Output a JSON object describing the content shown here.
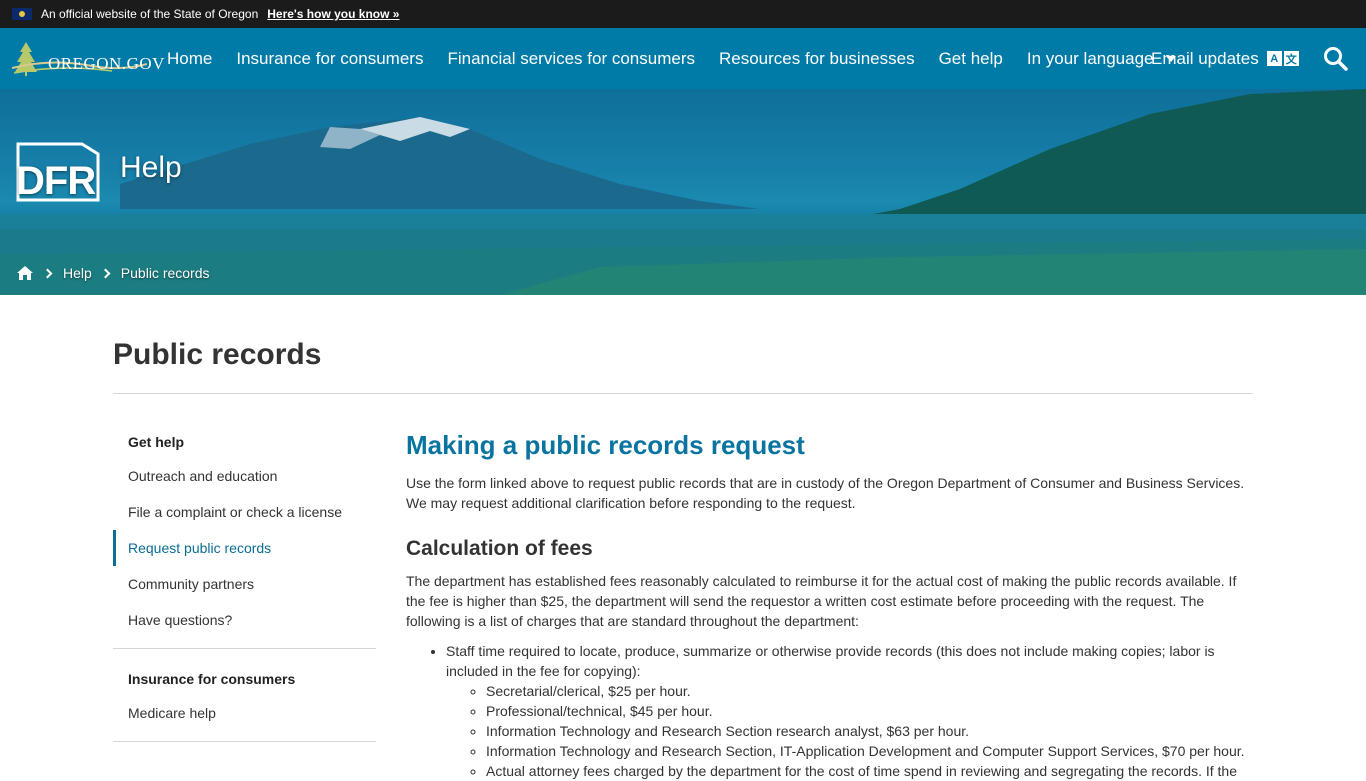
{
  "banner": {
    "official_text": "An official website of the State of Oregon",
    "howto_link": "Here's how you know »"
  },
  "nav": {
    "logo_text": "OREGON.GOV",
    "items": [
      "Home",
      "Insurance for consumers",
      "Financial services for consumers",
      "Resources for businesses",
      "Get help",
      "In your language"
    ],
    "email_updates": "Email updates",
    "lang_glyphs": [
      "A",
      "文"
    ]
  },
  "hero": {
    "logo": "DFR",
    "title": "Help",
    "breadcrumb": [
      "Help",
      "Public records"
    ]
  },
  "page": {
    "title": "Public records"
  },
  "sidebar": {
    "section1_head": "Get help",
    "section1_items": [
      "Outreach and education",
      "File a complaint or check a license",
      "Request public records",
      "Community partners",
      "Have questions?"
    ],
    "active_index": 2,
    "section2_head": "Insurance for consumers",
    "section2_items": [
      "Medicare help"
    ]
  },
  "main": {
    "heading": "Making a public records request",
    "intro": "Use the form linked above to request public records that are in custody of the Oregon Department of Consumer and Business Services. We may request additional clarification before responding to the request.",
    "fees_heading": "Calculation of fees",
    "fees_text": "The department has established fees reasonably calculated to reimburse it for the actual cost of making the public records available. If the fee is higher than $25, the department will send the requestor a written cost estimate before proceeding with the request. The following is a list of charges that are standard throughout the department:",
    "bullet1": "Staff time required to locate, produce, summarize or otherwise provide records (this does not include making copies; labor is included in the fee for copying):",
    "sub_bullets": [
      "Secretarial/clerical, $25 per hour.",
      "Professional/technical, $45 per hour.",
      "Information Technology and Research Section research analyst, $63 per hour.",
      "Information Technology and Research Section, IT-Application Development and Computer Support Services, $70 per hour.",
      "Actual attorney fees charged by the department for the cost of time spend in reviewing and segregating the records. If the"
    ]
  }
}
